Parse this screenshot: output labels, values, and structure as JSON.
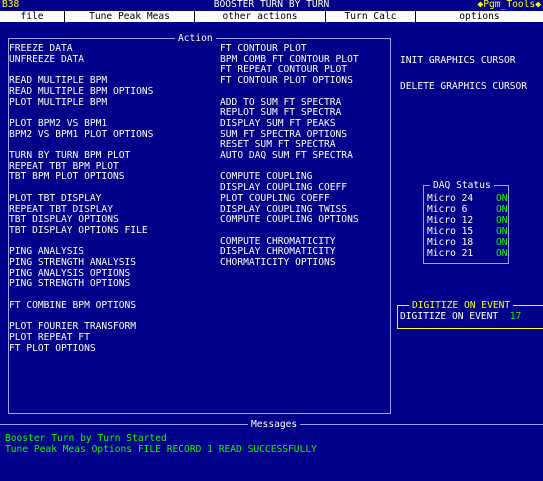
{
  "window": {
    "id": "B38",
    "title": "BOOSTER TURN BY TURN",
    "pgm_tools": "◆Pgm_Tools◆"
  },
  "menubar": [
    "file",
    "Tune Peak Meas",
    "other actions",
    "Turn Calc",
    "options"
  ],
  "action": {
    "title": "Action",
    "col1": [
      "FREEZE DATA",
      "UNFREEZE DATA",
      "",
      "READ MULTIPLE BPM",
      "READ MULTIPLE BPM OPTIONS",
      "PLOT MULTIPLE BPM",
      "",
      "PLOT BPM2 VS BPM1",
      "BPM2 VS BPM1 PLOT OPTIONS",
      "",
      "TURN BY TURN BPM PLOT",
      "REPEAT TBT BPM PLOT",
      "TBT BPM PLOT OPTIONS",
      "",
      "PLOT TBT DISPLAY",
      "REPEAT TBT DISPLAY",
      "TBT DISPLAY OPTIONS",
      "TBT DISPLAY OPTIONS FILE",
      "",
      "PING ANALYSIS",
      "PING STRENGTH ANALYSIS",
      "PING ANALYSIS OPTIONS",
      "PING STRENGTH OPTIONS",
      "",
      "FT COMBINE BPM OPTIONS",
      "",
      "PLOT FOURIER TRANSFORM",
      "PLOT REPEAT FT",
      "FT PLOT OPTIONS"
    ],
    "col2": [
      "FT CONTOUR PLOT",
      "BPM COMB FT CONTOUR PLOT",
      "FT REPEAT CONTOUR PLOT",
      "FT CONTOUR PLOT OPTIONS",
      "",
      "ADD TO SUM FT SPECTRA",
      "REPLOT SUM FT SPECTRA",
      "DISPLAY SUM FT PEAKS",
      "SUM FT SPECTRA OPTIONS",
      "RESET SUM FT SPECTRA",
      "AUTO DAQ SUM FT SPECTRA",
      "",
      "COMPUTE COUPLING",
      "DISPLAY COUPLING COEFF",
      "PLOT COUPLING COEFF",
      "DISPLAY COUPLING TWISS",
      "COMPUTE COUPLING OPTIONS",
      "",
      "COMPUTE CHROMATICITY",
      "DISPLAY CHROMATICITY",
      "CHORMATICITY OPTIONS"
    ]
  },
  "graphics": {
    "init_cursor": "INIT GRAPHICS CURSOR",
    "delete_cursor": "DELETE GRAPHICS CURSOR"
  },
  "daq_status": {
    "title": "DAQ Status",
    "rows": [
      {
        "name": "Micro 24",
        "state": "ON"
      },
      {
        "name": "Micro 6",
        "state": "ON"
      },
      {
        "name": "Micro 12",
        "state": "ON"
      },
      {
        "name": "Micro 15",
        "state": "ON"
      },
      {
        "name": "Micro 18",
        "state": "ON"
      },
      {
        "name": "Micro 21",
        "state": "ON"
      }
    ]
  },
  "digitize": {
    "title": "DIGITIZE ON EVENT",
    "label": "DIGITIZE ON EVENT",
    "value": "17"
  },
  "messages": {
    "title": "Messages",
    "lines": [
      "Booster Turn by Turn Started",
      "Tune Peak Meas Options FILE RECORD 1 READ SUCCESSFULLY"
    ]
  },
  "colors": {
    "background": "#00008a",
    "highlight": "#ffff00",
    "ok": "#00ff00",
    "frame": "#a0a0ff"
  }
}
